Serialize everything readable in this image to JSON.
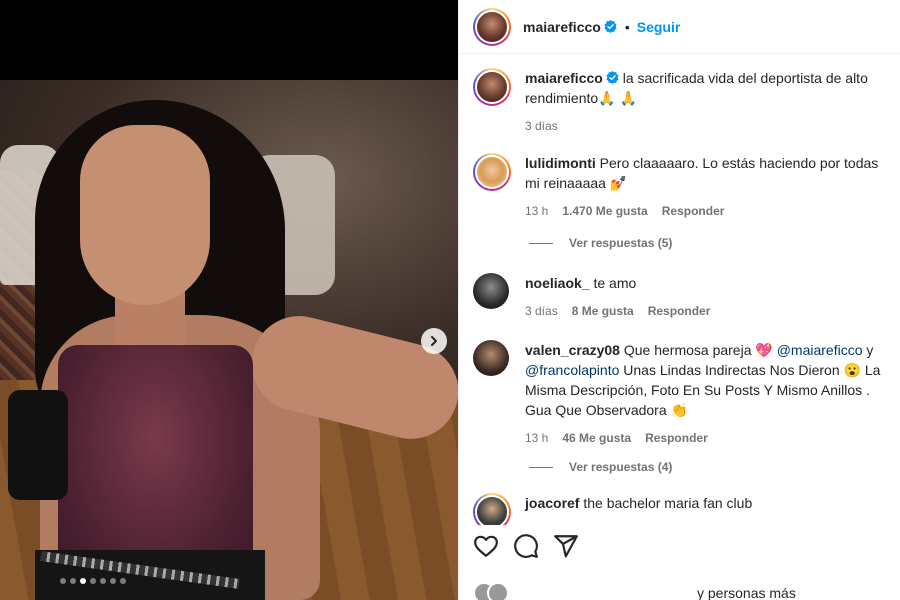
{
  "post": {
    "username": "maiareficco",
    "follow_label": "Seguir",
    "separator": "•",
    "carousel": {
      "dot_count": 7,
      "active_index": 2
    }
  },
  "comments": [
    {
      "username": "maiareficco",
      "verified": true,
      "text": "la sacrificada vida del deportista de alto rendimiento🙏 🙏",
      "time": "3 días"
    },
    {
      "username": "lulidimonti",
      "verified": false,
      "text": "Pero claaaaaro. Lo estás haciendo por todas mi reinaaaaa 💅",
      "time": "13 h",
      "likes": "1.470 Me gusta",
      "reply": "Responder",
      "view_replies": "Ver respuestas (5)"
    },
    {
      "username": "noeliaok_",
      "verified": false,
      "text": "te amo",
      "time": "3 días",
      "likes": "8 Me gusta",
      "reply": "Responder"
    },
    {
      "username": "valen_crazy08",
      "verified": false,
      "text_before": "Que hermosa pareja 💖 ",
      "mention1": "@maiareficco",
      "text_mid": " y ",
      "mention2": "@francolapinto",
      "text_after": " Unas Lindas Indirectas Nos Dieron 😮 La Misma Descripción, Foto En Su Posts Y Mismo Anillos . Gua Que Observadora 👏",
      "time": "13 h",
      "likes": "46 Me gusta",
      "reply": "Responder",
      "view_replies": "Ver respuestas (4)"
    },
    {
      "username": "joacoref",
      "verified": false,
      "text": "the bachelor maria fan club"
    }
  ],
  "footer": {
    "liked_by_text": "y personas más"
  },
  "icons": {
    "like": "heart-icon",
    "comment": "comment-icon",
    "share": "share-icon",
    "next": "chevron-right-icon",
    "verified": "verified-badge-icon"
  },
  "colors": {
    "accent": "#0095f6",
    "verified": "#0095f6",
    "muted": "#737373",
    "mention": "#00376b"
  }
}
